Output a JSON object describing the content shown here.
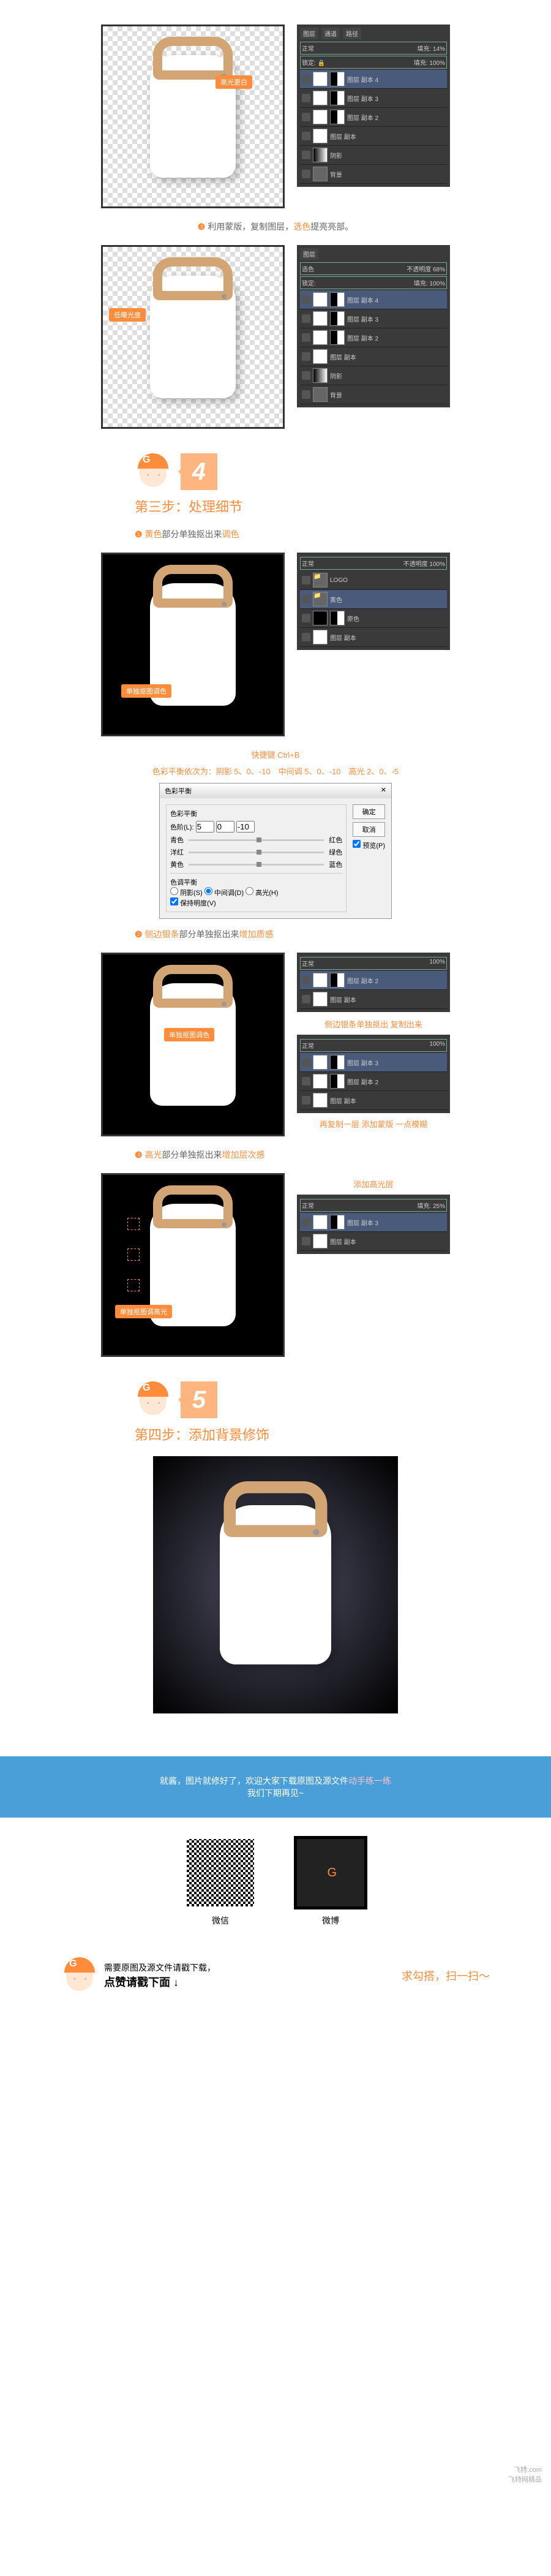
{
  "labels": {
    "label_top1": "高光更白",
    "label_top2": "低曝光度",
    "caption3": {
      "num": "❸",
      "text1": "利用蒙版，复制图层，",
      "hl": "选色",
      "text2": "提亮亮部。"
    },
    "label_mid": "低曝光度"
  },
  "step3": {
    "num": "4",
    "title": "第三步：处理细节",
    "sub1": {
      "num": "❶",
      "hl1": "黄色",
      "text": "部分单独抠出来",
      "hl2": "调色"
    },
    "imglabel1": "单独抠图调色",
    "shortcut": "快捷键 Ctrl+B",
    "balance": "色彩平衡依次为：阴影 5、0、-10　中间调 5、0、-10　高光 2、0、-5",
    "sub2": {
      "num": "❷",
      "hl1": "侧边银条",
      "text": "部分单独抠出来",
      "hl2": "增加质感"
    },
    "imglabel2": "单独抠图调色",
    "anno2a": "侧边银条单独抠出 复制出来",
    "anno2b": "再复制一层 添加蒙版 一点模糊",
    "sub3": {
      "num": "❸",
      "hl1": "高光",
      "text": "部分单独抠出来",
      "hl2": "增加层次感"
    },
    "imglabel3": "单独抠图调高光",
    "anno3": "添加高光层"
  },
  "step4": {
    "num": "5",
    "title": "第四步：添加背景修饰"
  },
  "bluebar": {
    "t1": "就酱，图片就修好了，欢迎大家下载原图及源文件",
    "hl": "动手练一练",
    "t2": "我们下期再见~"
  },
  "footer": {
    "line1": "需要原图及源文件请戳下载，",
    "line2": "点赞请戳下面",
    "qr1": "微信",
    "qr2": "微博",
    "scan": "求勾搭，扫一扫～"
  },
  "watermark": {
    "l1": "飞特.com",
    "l2": "飞特网精品"
  },
  "psPanel": {
    "tabs": [
      "图层",
      "通道",
      "路径"
    ],
    "mode": "选色",
    "opacity": "不透明度",
    "opVal": "68%",
    "lock": "锁定:",
    "fill": "填充:",
    "fillVal": "100%",
    "layers": {
      "bg": "背景",
      "copy": "图层 副本",
      "copy2": "图层 副本 2",
      "copy3": "图层 副本 3",
      "copy4": "图层 副本 4",
      "shadow": "阴影",
      "logo": "LOGO",
      "yellow": "黄色",
      "orig": "原色",
      "norm": "正常",
      "fill14": "14%",
      "fill25": "25%"
    }
  },
  "dialog": {
    "title": "色彩平衡",
    "bal": "色彩平衡",
    "levels": "色阶(L):",
    "v1": "5",
    "v2": "0",
    "v3": "-10",
    "cyan": "青色",
    "red": "红色",
    "mag": "洋红",
    "green": "绿色",
    "yel": "黄色",
    "blue": "蓝色",
    "tone": "色调平衡",
    "shadow": "阴影(S)",
    "mid": "中间调(D)",
    "high": "高光(H)",
    "preserve": "保持明度(V)",
    "ok": "确定",
    "cancel": "取消",
    "preview": "预览(P)"
  }
}
